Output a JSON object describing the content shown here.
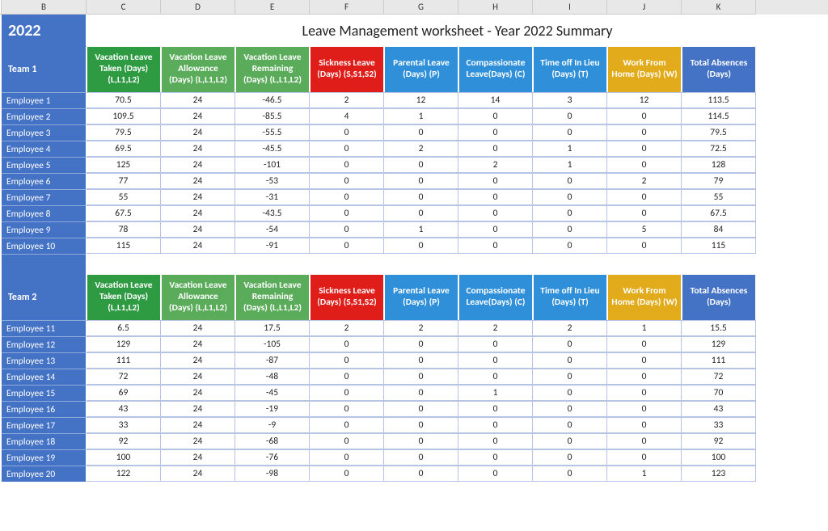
{
  "column_letters": [
    "B",
    "C",
    "D",
    "E",
    "F",
    "G",
    "H",
    "I",
    "J",
    "K"
  ],
  "year": "2022",
  "title": "Leave Management worksheet - Year 2022 Summary",
  "headers": {
    "vac_taken": "Vacation Leave Taken (Days) (L,L1,L2)",
    "vac_allow": "Vacation Leave Allowance (Days) (L,L1,L2)",
    "vac_remain": "Vacation Leave Remaining (Days) (L,L1,L2)",
    "sick": "Sickness Leave (Days) (S,S1,S2)",
    "parental": "Parental Leave (Days) (P)",
    "compassion": "Compassionate Leave(Days) (C)",
    "toil": "Time off In Lieu (Days) (T)",
    "wfh": "Work From Home (Days) (W)",
    "total": "Total Absences (Days)"
  },
  "teams": [
    {
      "name": "Team 1",
      "rows": [
        {
          "emp": "Employee 1",
          "c": "70.5",
          "d": "24",
          "e": "-46.5",
          "f": "2",
          "g": "12",
          "h": "14",
          "i": "3",
          "j": "12",
          "k": "113.5"
        },
        {
          "emp": "Employee 2",
          "c": "109.5",
          "d": "24",
          "e": "-85.5",
          "f": "4",
          "g": "1",
          "h": "0",
          "i": "0",
          "j": "0",
          "k": "114.5"
        },
        {
          "emp": "Employee 3",
          "c": "79.5",
          "d": "24",
          "e": "-55.5",
          "f": "0",
          "g": "0",
          "h": "0",
          "i": "0",
          "j": "0",
          "k": "79.5"
        },
        {
          "emp": "Employee 4",
          "c": "69.5",
          "d": "24",
          "e": "-45.5",
          "f": "0",
          "g": "2",
          "h": "0",
          "i": "1",
          "j": "0",
          "k": "72.5"
        },
        {
          "emp": "Employee 5",
          "c": "125",
          "d": "24",
          "e": "-101",
          "f": "0",
          "g": "0",
          "h": "2",
          "i": "1",
          "j": "0",
          "k": "128"
        },
        {
          "emp": "Employee 6",
          "c": "77",
          "d": "24",
          "e": "-53",
          "f": "0",
          "g": "0",
          "h": "0",
          "i": "0",
          "j": "2",
          "k": "79"
        },
        {
          "emp": "Employee 7",
          "c": "55",
          "d": "24",
          "e": "-31",
          "f": "0",
          "g": "0",
          "h": "0",
          "i": "0",
          "j": "0",
          "k": "55"
        },
        {
          "emp": "Employee 8",
          "c": "67.5",
          "d": "24",
          "e": "-43.5",
          "f": "0",
          "g": "0",
          "h": "0",
          "i": "0",
          "j": "0",
          "k": "67.5"
        },
        {
          "emp": "Employee 9",
          "c": "78",
          "d": "24",
          "e": "-54",
          "f": "0",
          "g": "1",
          "h": "0",
          "i": "0",
          "j": "5",
          "k": "84"
        },
        {
          "emp": "Employee 10",
          "c": "115",
          "d": "24",
          "e": "-91",
          "f": "0",
          "g": "0",
          "h": "0",
          "i": "0",
          "j": "0",
          "k": "115"
        }
      ]
    },
    {
      "name": "Team 2",
      "rows": [
        {
          "emp": "Employee 11",
          "c": "6.5",
          "d": "24",
          "e": "17.5",
          "f": "2",
          "g": "2",
          "h": "2",
          "i": "2",
          "j": "1",
          "k": "15.5"
        },
        {
          "emp": "Employee 12",
          "c": "129",
          "d": "24",
          "e": "-105",
          "f": "0",
          "g": "0",
          "h": "0",
          "i": "0",
          "j": "0",
          "k": "129"
        },
        {
          "emp": "Employee 13",
          "c": "111",
          "d": "24",
          "e": "-87",
          "f": "0",
          "g": "0",
          "h": "0",
          "i": "0",
          "j": "0",
          "k": "111"
        },
        {
          "emp": "Employee 14",
          "c": "72",
          "d": "24",
          "e": "-48",
          "f": "0",
          "g": "0",
          "h": "0",
          "i": "0",
          "j": "0",
          "k": "72"
        },
        {
          "emp": "Employee 15",
          "c": "69",
          "d": "24",
          "e": "-45",
          "f": "0",
          "g": "0",
          "h": "1",
          "i": "0",
          "j": "0",
          "k": "70"
        },
        {
          "emp": "Employee 16",
          "c": "43",
          "d": "24",
          "e": "-19",
          "f": "0",
          "g": "0",
          "h": "0",
          "i": "0",
          "j": "0",
          "k": "43"
        },
        {
          "emp": "Employee 17",
          "c": "33",
          "d": "24",
          "e": "-9",
          "f": "0",
          "g": "0",
          "h": "0",
          "i": "0",
          "j": "0",
          "k": "33"
        },
        {
          "emp": "Employee 18",
          "c": "92",
          "d": "24",
          "e": "-68",
          "f": "0",
          "g": "0",
          "h": "0",
          "i": "0",
          "j": "0",
          "k": "92"
        },
        {
          "emp": "Employee 19",
          "c": "100",
          "d": "24",
          "e": "-76",
          "f": "0",
          "g": "0",
          "h": "0",
          "i": "0",
          "j": "0",
          "k": "100"
        },
        {
          "emp": "Employee 20",
          "c": "122",
          "d": "24",
          "e": "-98",
          "f": "0",
          "g": "0",
          "h": "0",
          "i": "0",
          "j": "1",
          "k": "123"
        }
      ]
    }
  ]
}
